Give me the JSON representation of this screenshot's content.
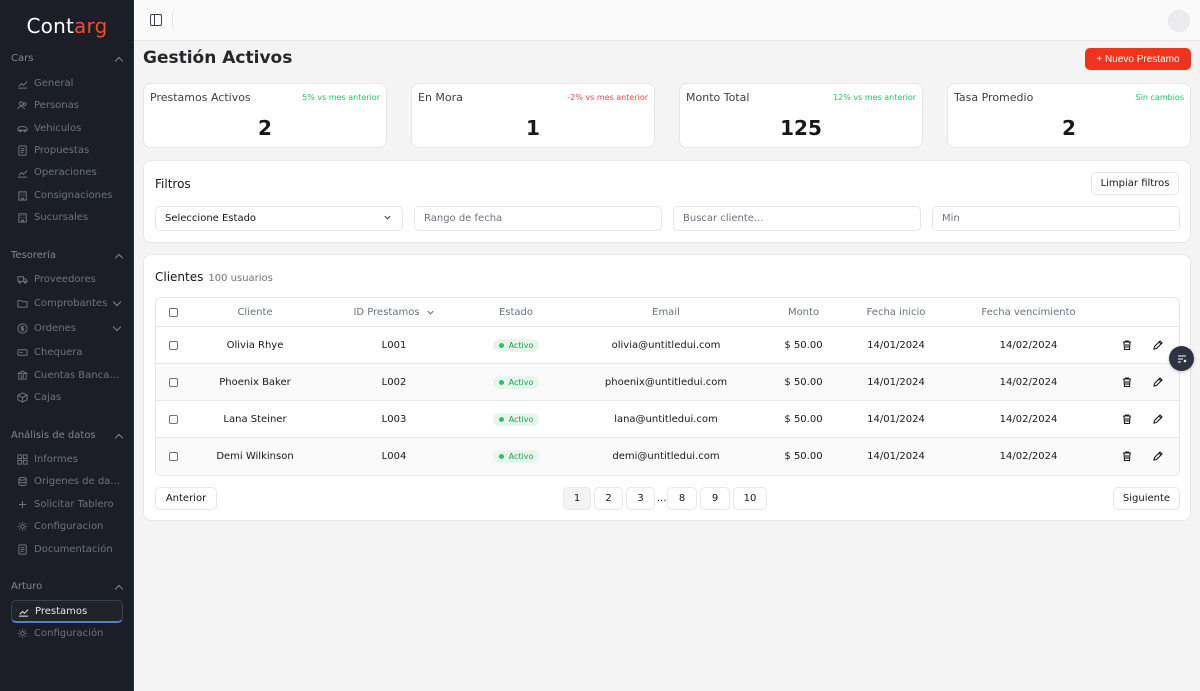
{
  "brand": {
    "name_part1": "Cont",
    "name_part2": "arg",
    "accent_color": "#f04a2c"
  },
  "sidebar": {
    "sections": [
      {
        "label": "Cars",
        "items": [
          {
            "label": "General",
            "icon": "chart-icon"
          },
          {
            "label": "Personas",
            "icon": "users-icon"
          },
          {
            "label": "Vehiculos",
            "icon": "car-icon"
          },
          {
            "label": "Propuestas",
            "icon": "document-icon"
          },
          {
            "label": "Operaciones",
            "icon": "chart-icon"
          },
          {
            "label": "Consignaciones",
            "icon": "building-icon"
          },
          {
            "label": "Sucursales",
            "icon": "building-icon"
          }
        ]
      },
      {
        "label": "Tesorería",
        "items": [
          {
            "label": "Proveedores",
            "icon": "truck-icon"
          },
          {
            "label": "Comprobantes",
            "icon": "folder-icon"
          },
          {
            "label": "Ordenes",
            "icon": "dollar-icon"
          },
          {
            "label": "Chequera",
            "icon": "cheque-icon"
          },
          {
            "label": "Cuentas Bancari...",
            "icon": "bank-icon"
          },
          {
            "label": "Cajas",
            "icon": "box-icon"
          }
        ]
      },
      {
        "label": "Análisis de datos",
        "items": [
          {
            "label": "Informes",
            "icon": "grid-icon"
          },
          {
            "label": "Origenes de datos",
            "icon": "database-icon"
          },
          {
            "label": "Solicitar Tablero",
            "icon": "plus-icon"
          },
          {
            "label": "Configuracion",
            "icon": "gear-icon"
          },
          {
            "label": "Documentación",
            "icon": "document-icon"
          }
        ]
      },
      {
        "label": "Arturo",
        "items": [
          {
            "label": "Prestamos",
            "icon": "chart-icon",
            "active": true
          },
          {
            "label": "Configuración",
            "icon": "gear-icon"
          }
        ]
      }
    ]
  },
  "header": {
    "title": "Gestión Activos",
    "new_button": "+ Nuevo Prestamo"
  },
  "stats": [
    {
      "title": "Prestamos Activos",
      "delta": "5% vs mes anterior",
      "delta_color": "#22c55e",
      "value": "2"
    },
    {
      "title": "En Mora",
      "delta": "-2% vs mes anterior",
      "delta_color": "#ef4444",
      "value": "1"
    },
    {
      "title": "Monto Total",
      "delta": "12% vs mes anterior",
      "delta_color": "#22c55e",
      "value": "125"
    },
    {
      "title": "Tasa Promedio",
      "delta": "Sin cambios",
      "delta_color": "#22c55e",
      "value": "2"
    }
  ],
  "filters": {
    "title": "Filtros",
    "clear_button": "Limpiar filtros",
    "estado_select": "Seleccione Estado",
    "date_placeholder": "Rango de fecha",
    "search_placeholder": "Buscar cliente...",
    "min_placeholder": "Min"
  },
  "clients": {
    "title": "Clientes",
    "count": "100 usuarios",
    "columns": [
      "Cliente",
      "ID Prestamos",
      "Estado",
      "Email",
      "Monto",
      "Fecha inicio",
      "Fecha vencimiento"
    ],
    "rows": [
      {
        "cliente": "Olivia Rhye",
        "id": "L001",
        "estado": "Activo",
        "email": "olivia@untitledui.com",
        "monto": "$ 50.00",
        "inicio": "14/01/2024",
        "venc": "14/02/2024"
      },
      {
        "cliente": "Phoenix Baker",
        "id": "L002",
        "estado": "Activo",
        "email": "phoenix@untitledui.com",
        "monto": "$ 50.00",
        "inicio": "14/01/2024",
        "venc": "14/02/2024"
      },
      {
        "cliente": "Lana Steiner",
        "id": "L003",
        "estado": "Activo",
        "email": "lana@untitledui.com",
        "monto": "$ 50.00",
        "inicio": "14/01/2024",
        "venc": "14/02/2024"
      },
      {
        "cliente": "Demi Wilkinson",
        "id": "L004",
        "estado": "Activo",
        "email": "demi@untitledui.com",
        "monto": "$ 50.00",
        "inicio": "14/01/2024",
        "venc": "14/02/2024"
      }
    ]
  },
  "pagination": {
    "prev": "Anterior",
    "next": "Siguiente",
    "pages": [
      "1",
      "2",
      "3",
      "8",
      "9",
      "10"
    ],
    "ellipsis": "...",
    "current": "1"
  }
}
